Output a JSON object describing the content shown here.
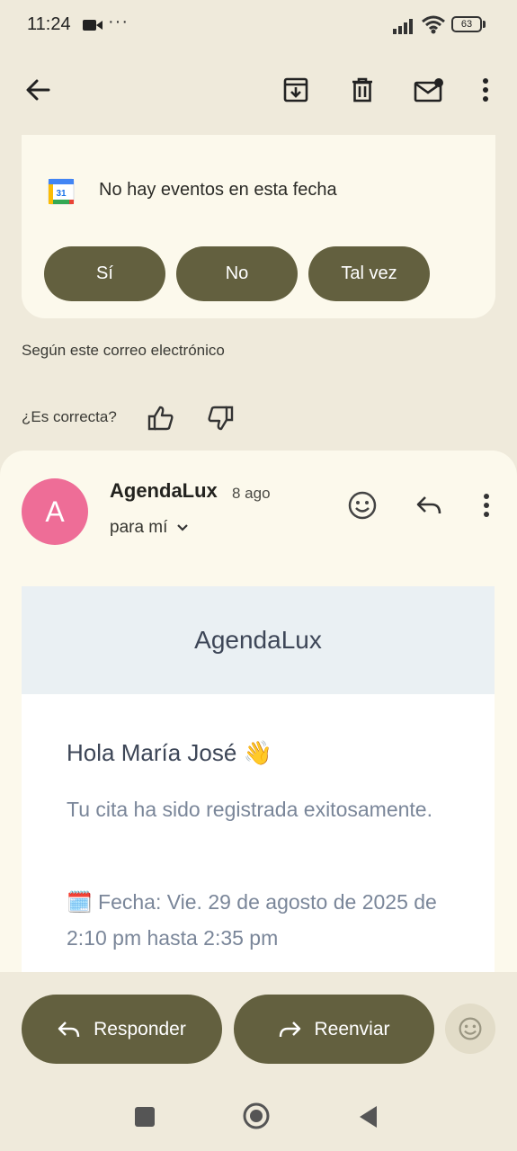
{
  "status_bar": {
    "time": "11:24",
    "more": "···",
    "battery": "63"
  },
  "toolbar": {
    "back_icon": "arrow-left-icon",
    "archive_icon": "archive-icon",
    "delete_icon": "trash-icon",
    "unread_icon": "mark-unread-icon",
    "more_icon": "more-vert-icon"
  },
  "calendar_card": {
    "calendar_icon_day": "31",
    "no_events": "No hay eventos en esta fecha",
    "rsvp": {
      "yes": "Sí",
      "no": "No",
      "maybe": "Tal vez"
    }
  },
  "feedback": {
    "source": "Según este correo electrónico",
    "question": "¿Es correcta?"
  },
  "message": {
    "avatar_letter": "A",
    "sender": "AgendaLux",
    "date": "8 ago",
    "recipient": "para mí",
    "email_header": "AgendaLux",
    "greeting": "Hola María José 👋",
    "line1": "Tu cita ha sido registrada exitosamente.",
    "line2": "🗓️ Fecha: Vie. 29 de agosto de 2025 de 2:10 pm hasta 2:35 pm"
  },
  "actions": {
    "reply": "Responder",
    "forward": "Reenviar"
  },
  "colors": {
    "accent": "#63603f",
    "avatar": "#ee6d97",
    "background": "#efeadb",
    "card": "#fcf9ec"
  }
}
